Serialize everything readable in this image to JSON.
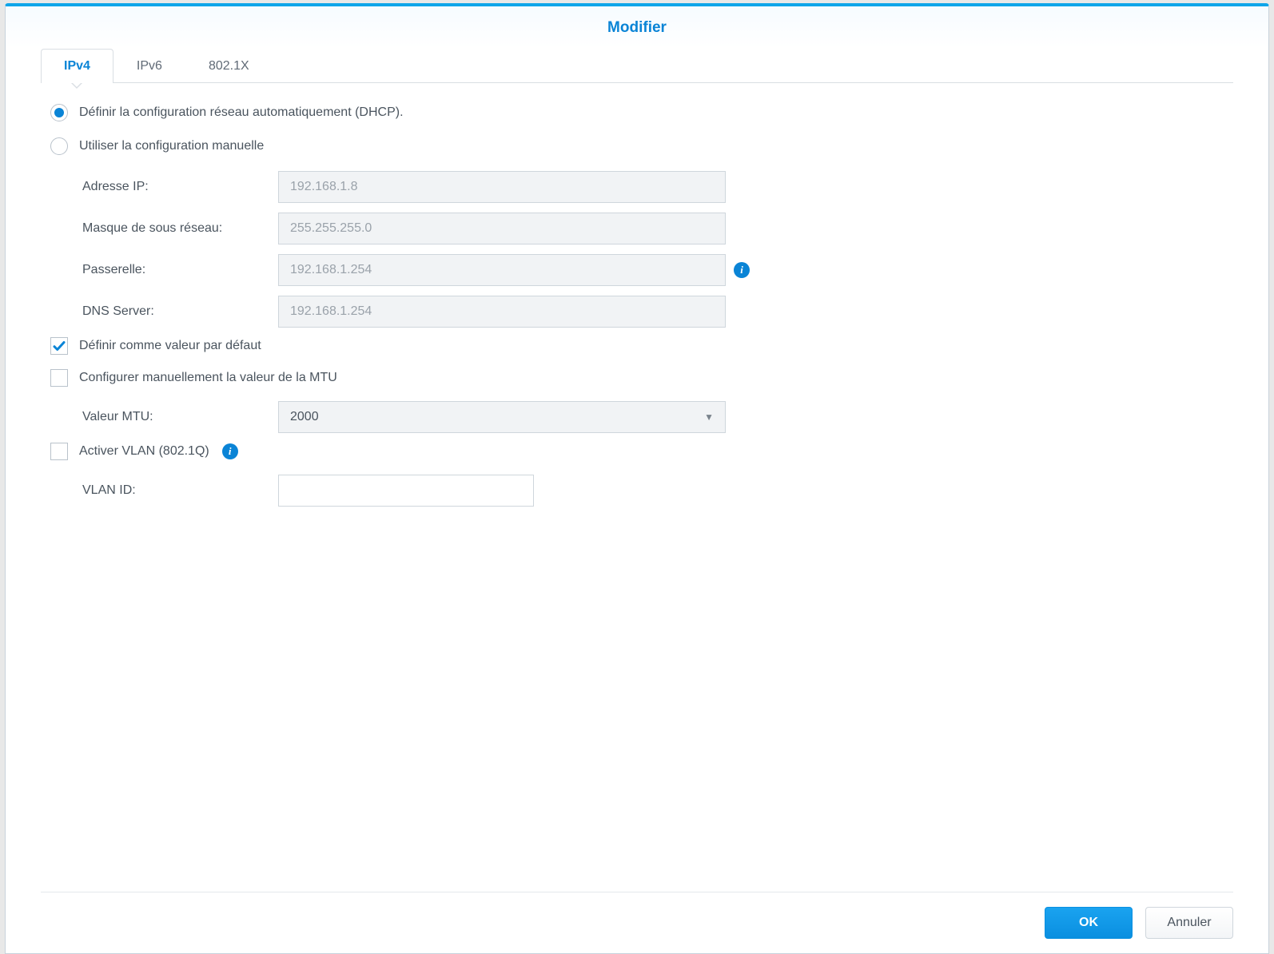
{
  "header": {
    "title": "Modifier"
  },
  "tabs": [
    {
      "label": "IPv4",
      "active": true
    },
    {
      "label": "IPv6",
      "active": false
    },
    {
      "label": "802.1X",
      "active": false
    }
  ],
  "config": {
    "dhcp_label": "Définir la configuration réseau automatiquement (DHCP).",
    "manual_label": "Utiliser la configuration manuelle",
    "ip_label": "Adresse IP:",
    "ip_value": "192.168.1.8",
    "subnet_label": "Masque de sous réseau:",
    "subnet_value": "255.255.255.0",
    "gateway_label": "Passerelle:",
    "gateway_value": "192.168.1.254",
    "dns_label": "DNS Server:",
    "dns_value": "192.168.1.254",
    "default_gw_label": "Définir comme valeur par défaut",
    "default_gw_checked": true,
    "mtu_config_label": "Configurer manuellement la valeur de la MTU",
    "mtu_config_checked": false,
    "mtu_label": "Valeur MTU:",
    "mtu_value": "2000",
    "vlan_enable_label": "Activer VLAN (802.1Q)",
    "vlan_enable_checked": false,
    "vlan_id_label": "VLAN ID:",
    "vlan_id_value": ""
  },
  "buttons": {
    "ok": "OK",
    "cancel": "Annuler"
  }
}
